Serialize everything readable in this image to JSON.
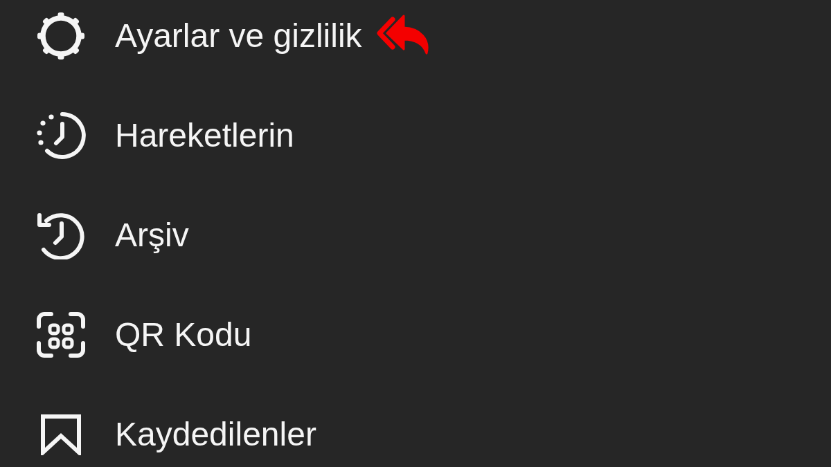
{
  "menu": {
    "items": [
      {
        "label": "Ayarlar ve gizlilik",
        "marked": true
      },
      {
        "label": "Hareketlerin",
        "marked": false
      },
      {
        "label": "Arşiv",
        "marked": false
      },
      {
        "label": "QR Kodu",
        "marked": false
      },
      {
        "label": "Kaydedilenler",
        "marked": false
      }
    ]
  }
}
